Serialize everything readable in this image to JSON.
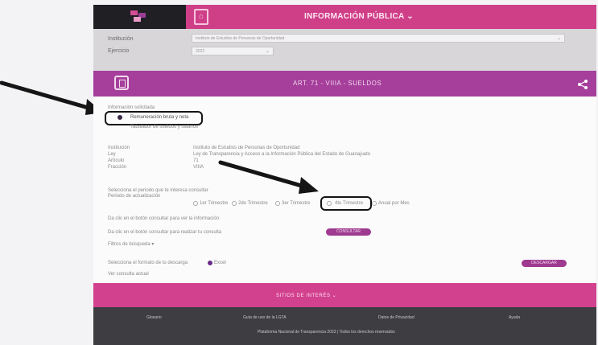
{
  "header": {
    "title": "INFORMACIÓN PÚBLICA ⌄",
    "home_label": "⌂"
  },
  "filters": {
    "institucion_label": "Institución",
    "institucion_value": "Instituto de Estudios de Personas de Oportunidad",
    "ejercicio_label": "Ejercicio",
    "ejercicio_value": "2022"
  },
  "section": {
    "title": "ART. 71 - VIIIA - SUELDOS"
  },
  "content": {
    "info_label": "Información solicitada",
    "option1": "Remuneración bruta y neta",
    "option2": "Tabulador de sueldos y salarios",
    "rows": [
      {
        "label": "Institución",
        "value": "Instituto de Estudios de Personas de Oportunidad"
      },
      {
        "label": "Ley",
        "value": "Ley de Transparencia y Acceso a la Información Pública del Estado de Guanajuato"
      },
      {
        "label": "Artículo",
        "value": "71"
      },
      {
        "label": "Fracción",
        "value": "VIIIA"
      }
    ],
    "period_note": "Selecciona el periodo que te interesa consultar",
    "period_label": "Periodo de actualización",
    "periods": [
      "1er Trimestre",
      "2do Trimestre",
      "3er Trimestre",
      "4to Trimestre",
      "Anual por Mes"
    ],
    "note2": "Da clic en el botón consultar para ver la información",
    "consult_prompt": "Da clic en el botón consultar para realizar tu consulta",
    "consult_button": "CONSULTAR",
    "advanced_filters": "Filtros de búsqueda ▾",
    "select_note": "Selecciona el formato de tu descarga",
    "excel_option": "Excel",
    "download_button": "DESCARGAR",
    "query_status": "Ver consulta actual"
  },
  "footer": {
    "title": "SITIOS DE INTERÉS ⌄",
    "links": [
      "Glosario",
      "Guía de uso de la LGTA",
      "Datos de Privacidad",
      "Ayuda"
    ],
    "copyright": "Plataforma Nacional de Transparencia 2023 | Todos los derechos reservados"
  },
  "colors": {
    "topbar": "#cf3f88",
    "purple": "#a53f9b",
    "footer_pink": "#d2418e",
    "footer_dark": "#3e3d41"
  }
}
